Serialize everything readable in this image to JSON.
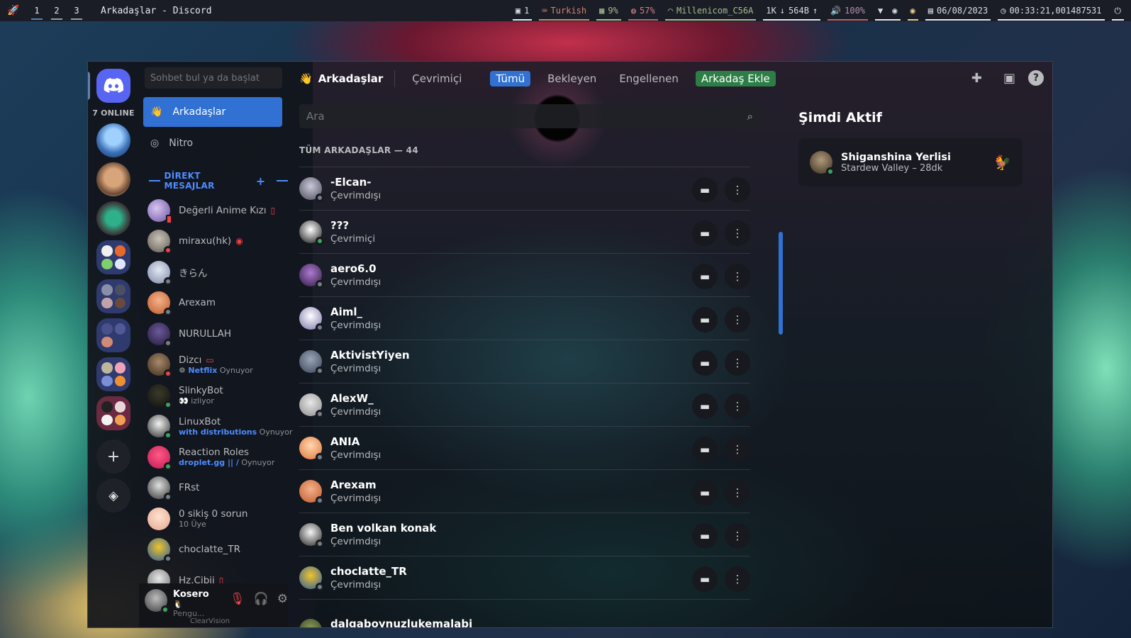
{
  "topbar": {
    "workspaces": [
      "1",
      "2",
      "3"
    ],
    "window_title": "Arkadaşlar - Discord",
    "modules": {
      "windows": "1",
      "keyboard": "Turkish",
      "cpu": "9%",
      "memory": "57%",
      "wifi": "Millenicom_C56A",
      "net_down": "1K",
      "net_up": "564B",
      "volume": "100%",
      "date": "06/08/2023",
      "time": "00:33:21,001487531"
    }
  },
  "guilds": {
    "online_count": "7 ONLINE"
  },
  "sidebar": {
    "search_placeholder": "Sohbet bul ya da başlat",
    "nav_friends": "Arkadaşlar",
    "nav_nitro": "Nitro",
    "dm_header": "DİREKT MESAJLAR",
    "dms": [
      {
        "name": "Değerli Anime Kızı",
        "sub": "",
        "status": "mobile"
      },
      {
        "name": "miraxu(hk)",
        "sub": "",
        "status": "dnd"
      },
      {
        "name": "きらん",
        "sub": "",
        "status": "offline"
      },
      {
        "name": "Arexam",
        "sub": "",
        "status": "offline"
      },
      {
        "name": "NURULLAH",
        "sub": "",
        "status": "offline"
      },
      {
        "name": "Dizcı",
        "sub_bold": "Netflix",
        "sub": "Oynuyor",
        "status": "dnd"
      },
      {
        "name": "SlinkyBot",
        "sub": "izliyor",
        "status": "online"
      },
      {
        "name": "LinuxBot",
        "sub_bold": "with distributions",
        "sub": "Oynuyor",
        "status": "online"
      },
      {
        "name": "Reaction Roles",
        "sub_bold": "droplet.gg || /",
        "sub": "Oynuyor",
        "status": "online"
      },
      {
        "name": "FRst",
        "sub": "",
        "status": "offline"
      },
      {
        "name": "0 sikiş 0 sorun",
        "sub": "10 Üye",
        "status": "none"
      },
      {
        "name": "choclatte_TR",
        "sub": "",
        "status": "offline"
      },
      {
        "name": "Hz.Cibii",
        "sub": "",
        "status": "mobile"
      }
    ],
    "user": {
      "name": "Kosero",
      "sub": "Pengu...",
      "footer": "ClearVision"
    }
  },
  "header": {
    "title": "Arkadaşlar",
    "tabs": [
      "Çevrimiçi",
      "Tümü",
      "Bekleyen",
      "Engellenen"
    ],
    "add_friend": "Arkadaş Ekle"
  },
  "friends": {
    "search_placeholder": "Ara",
    "count_label": "TÜM ARKADAŞLAR — 44",
    "list": [
      {
        "name": "-Elcan-",
        "status": "Çevrimdışı"
      },
      {
        "name": "???",
        "status": "Çevrimiçi"
      },
      {
        "name": "aero6.0",
        "status": "Çevrimdışı"
      },
      {
        "name": "Aiml_",
        "status": "Çevrimdışı"
      },
      {
        "name": "AktivistYiyen",
        "status": "Çevrimdışı"
      },
      {
        "name": "AlexW_",
        "status": "Çevrimdışı"
      },
      {
        "name": "ANIA",
        "status": "Çevrimdışı"
      },
      {
        "name": "Arexam",
        "status": "Çevrimdışı"
      },
      {
        "name": "Ben volkan konak",
        "status": "Çevrimdışı"
      },
      {
        "name": "choclatte_TR",
        "status": "Çevrimdışı"
      },
      {
        "name": "dalgaboynuzlukemalabi",
        "status": ""
      }
    ]
  },
  "active_now": {
    "title": "Şimdi Aktif",
    "name": "Shiganshina Yerlisi",
    "game": "Stardew Valley – 28dk"
  }
}
